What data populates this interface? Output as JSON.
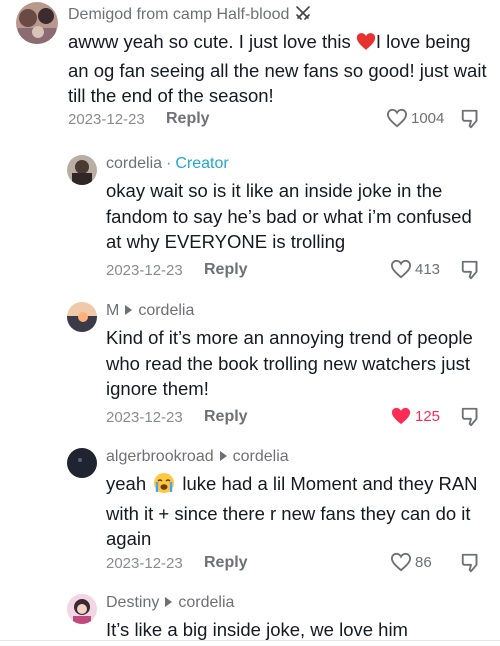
{
  "comments": [
    {
      "username": "Demigod from camp Half-blood",
      "badge_icon": "crossed-swords-icon",
      "text_a": "awww yeah so cute. I just love this ",
      "text_b": "I love being an og fan seeing all the new fans so good! just wait till the end of the season!",
      "date": "2023-12-23",
      "reply_label": "Reply",
      "likes": "1004",
      "liked": false
    },
    {
      "username": "cordelia",
      "creator_label": "Creator",
      "separator": "·",
      "text": "okay wait so is it like an inside joke in the fandom to say he’s bad or what i’m confused at why EVERYONE is trolling",
      "date": "2023-12-23",
      "reply_label": "Reply",
      "likes": "413",
      "liked": false
    },
    {
      "username": "M",
      "reply_to": "cordelia",
      "text": "Kind of it’s more an annoying trend of people who read the book trolling new watchers just ignore them!",
      "date": "2023-12-23",
      "reply_label": "Reply",
      "likes": "125",
      "liked": true,
      "like_color": "#fe2c55"
    },
    {
      "username": "algerbrookroad",
      "reply_to": "cordelia",
      "text_a": "yeah ",
      "text_b": " luke had a lil Moment and they RAN with it + since there r new fans they can do it again",
      "date": "2023-12-23",
      "reply_label": "Reply",
      "likes": "86",
      "liked": false
    },
    {
      "username": "Destiny",
      "reply_to": "cordelia",
      "text": "It’s like a big inside joke, we love him"
    }
  ]
}
